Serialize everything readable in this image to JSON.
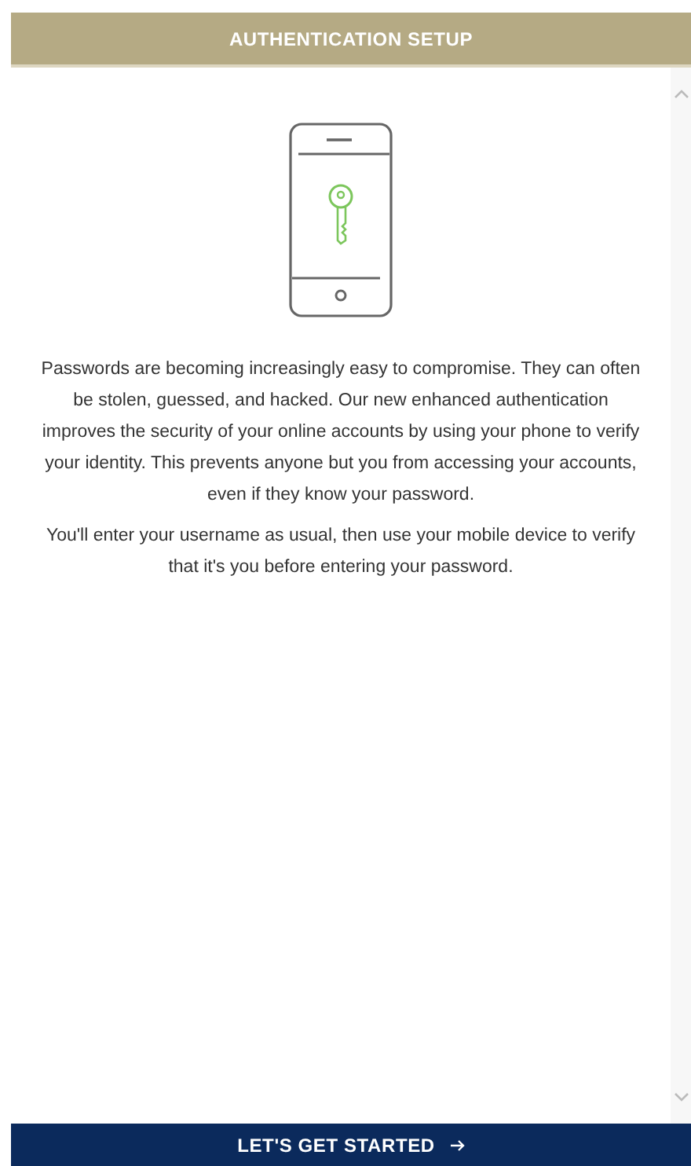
{
  "header": {
    "title": "AUTHENTICATION SETUP"
  },
  "paragraphs": [
    "Passwords are becoming increasingly easy to compromise. They can often be stolen, guessed, and hacked. Our new enhanced authentication improves the security of your online accounts by using your phone to verify your identity. This prevents anyone but you from accessing your accounts, even if they know your password.",
    "You'll enter your username as usual, then use your mobile device to verify that it's you before entering your password."
  ],
  "button": {
    "label": "LET'S GET STARTED"
  }
}
